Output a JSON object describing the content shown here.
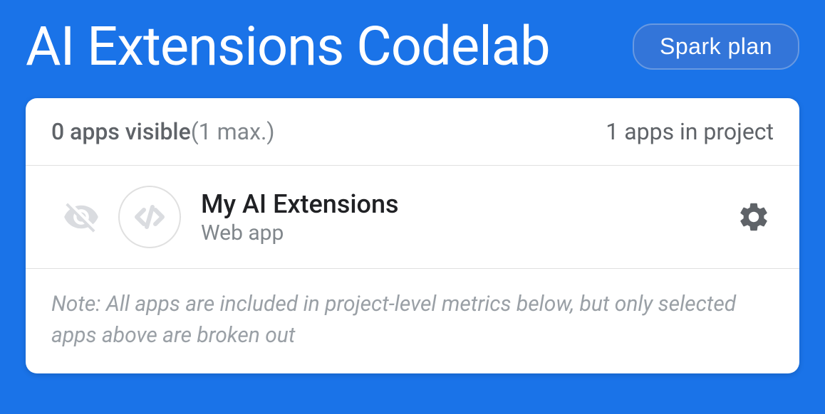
{
  "header": {
    "title": "AI Extensions Codelab",
    "plan_label": "Spark plan"
  },
  "card": {
    "apps_visible_count": "0 apps visible",
    "apps_visible_max": "(1 max.)",
    "apps_in_project": "1 apps in project",
    "app": {
      "name": "My AI Extensions",
      "type": "Web app"
    },
    "note": "Note: All apps are included in project-level metrics below, but only selected apps above are broken out"
  },
  "colors": {
    "primary_bg": "#1a73e8",
    "card_bg": "#ffffff",
    "text_muted": "#5f6368",
    "text_light": "#9aa0a6",
    "icon_disabled": "#dadce0"
  }
}
